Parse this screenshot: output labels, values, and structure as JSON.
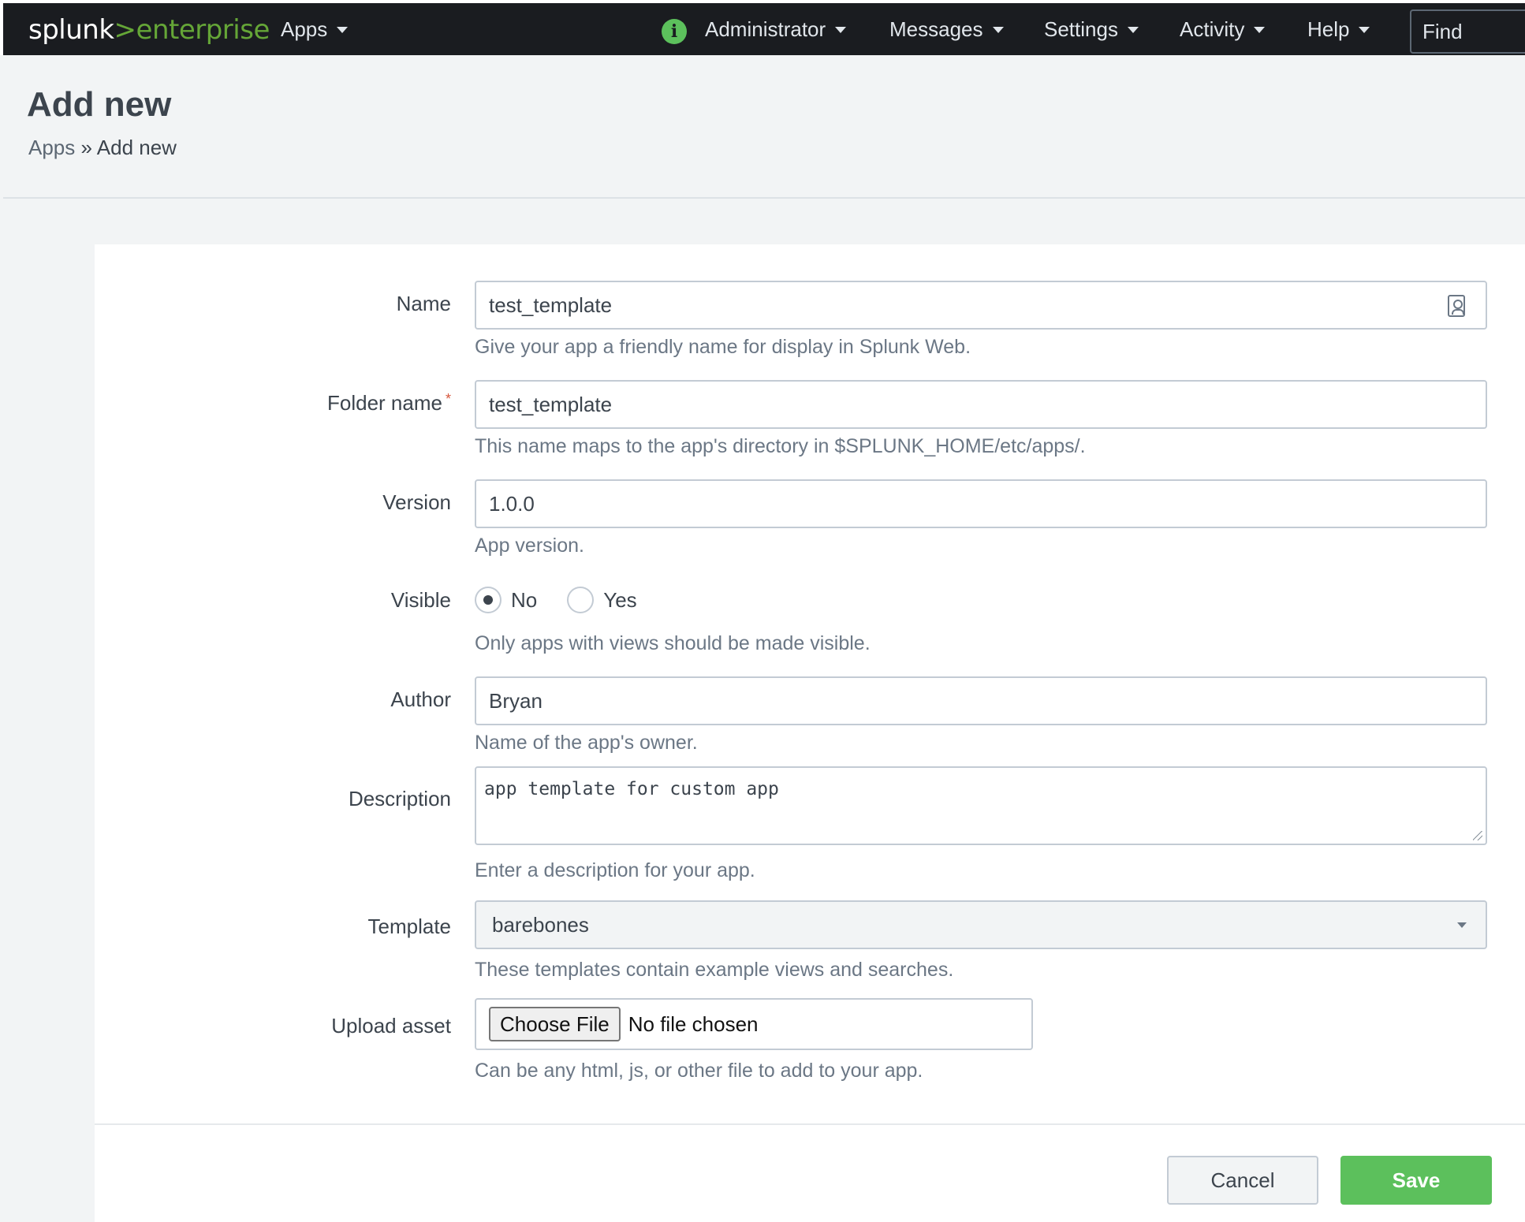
{
  "topbar": {
    "logo_main": "splunk",
    "logo_sep": ">",
    "logo_product": "enterprise",
    "apps": "Apps",
    "info_icon": "i",
    "administrator": "Administrator",
    "messages": "Messages",
    "settings": "Settings",
    "activity": "Activity",
    "help": "Help",
    "find": "Find"
  },
  "header": {
    "title": "Add new",
    "breadcrumb_parent": "Apps",
    "breadcrumb_sep": "»",
    "breadcrumb_current": "Add new"
  },
  "form": {
    "name": {
      "label": "Name",
      "value": "test_template",
      "help": "Give your app a friendly name for display in Splunk Web."
    },
    "folder": {
      "label": "Folder name",
      "required": "*",
      "value": "test_template",
      "help": "This name maps to the app's directory in $SPLUNK_HOME/etc/apps/."
    },
    "version": {
      "label": "Version",
      "value": "1.0.0",
      "help": "App version."
    },
    "visible": {
      "label": "Visible",
      "option_no": "No",
      "option_yes": "Yes",
      "selected": "No",
      "help": "Only apps with views should be made visible."
    },
    "author": {
      "label": "Author",
      "value": "Bryan",
      "help": "Name of the app's owner."
    },
    "description": {
      "label": "Description",
      "value": "app template for custom app",
      "help": "Enter a description for your app."
    },
    "template": {
      "label": "Template",
      "value": "barebones",
      "help": "These templates contain example views and searches."
    },
    "upload": {
      "label": "Upload asset",
      "button": "Choose File",
      "status": "No file chosen",
      "help": "Can be any html, js, or other file to add to your app."
    }
  },
  "actions": {
    "cancel": "Cancel",
    "save": "Save"
  },
  "colors": {
    "accent_green": "#5cc05c",
    "topbar_bg": "#1a1c20"
  }
}
